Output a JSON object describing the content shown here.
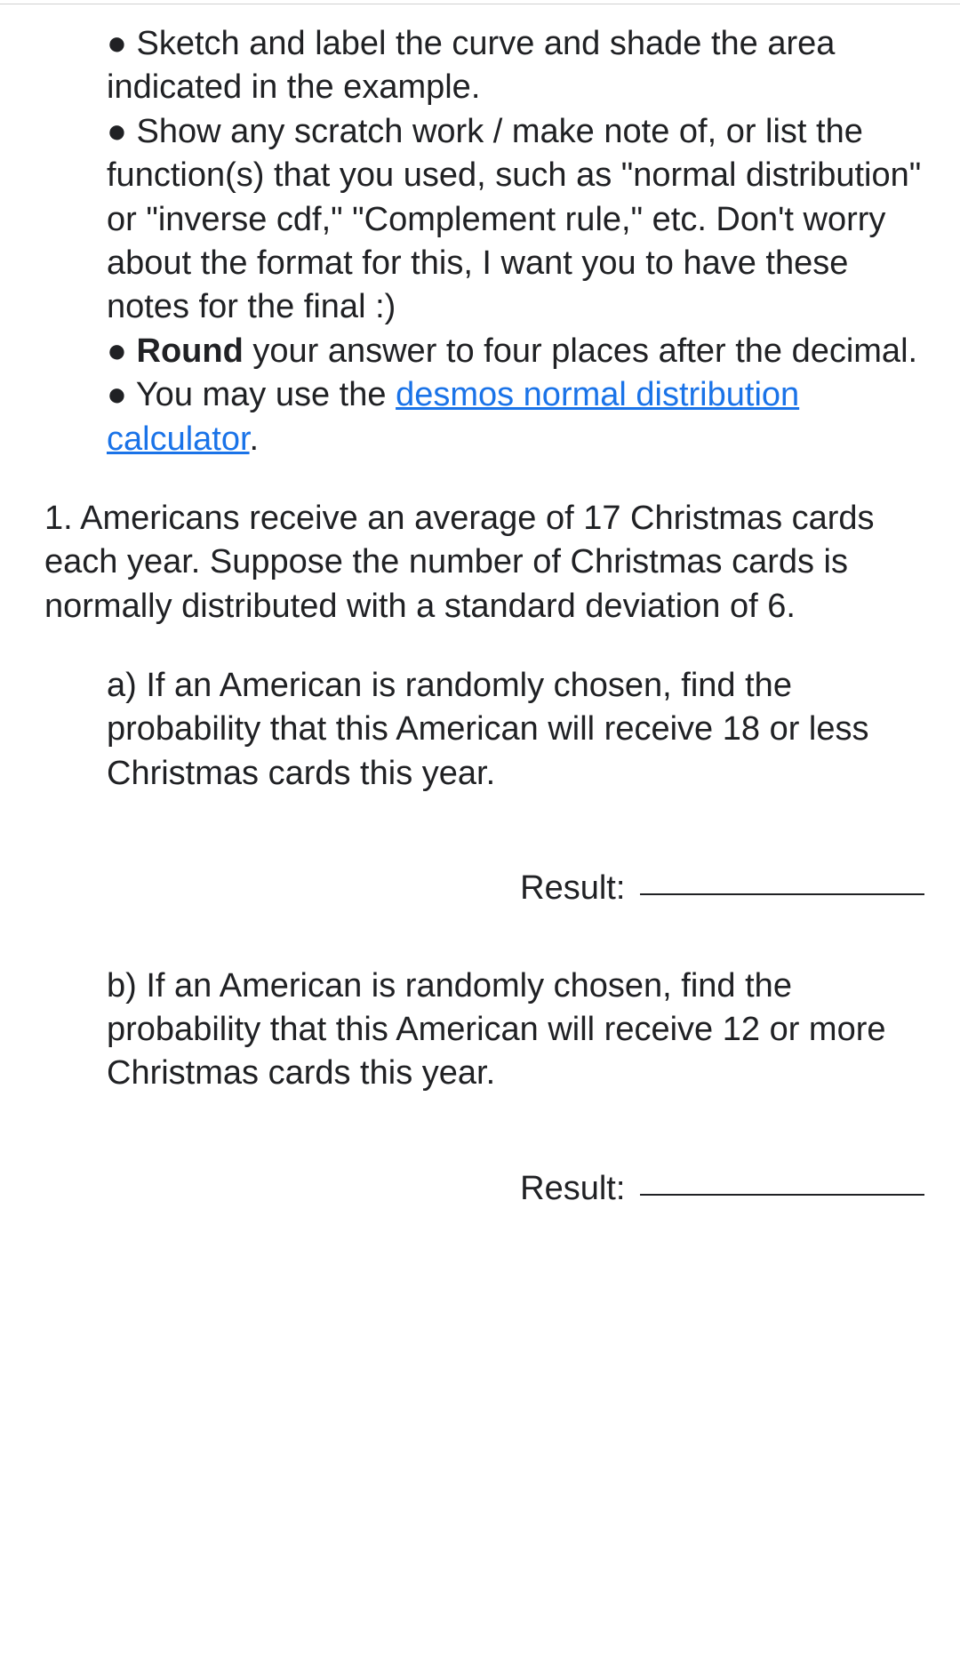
{
  "instructions": {
    "bullet1": "● Sketch and label the curve and shade the area indicated in the example.",
    "bullet2": "● Show any scratch work / make note of, or list the function(s) that you used, such as \"normal distribution\" or \"inverse cdf,\" \"Complement rule,\" etc. Don't worry about the format for this, I want you to have these notes for the final :)",
    "bullet3_pre": "● ",
    "bullet3_bold": "Round",
    "bullet3_post": " your answer to four places after the decimal.",
    "bullet4_pre": "● You may use the ",
    "bullet4_link": "desmos normal distribution calculator",
    "bullet4_post": "."
  },
  "question1": {
    "stem": "1. Americans receive an average of 17 Christmas cards each year. Suppose the number of Christmas cards is normally distributed with a standard deviation of 6.",
    "part_a": "a) If an American is randomly chosen, find the probability that this American will receive 18 or less Christmas cards this year.",
    "result_a_label": "Result:",
    "part_b": "b) If an American is randomly chosen, find the probability that this American will receive 12 or more Christmas cards this year.",
    "result_b_label": "Result:"
  }
}
